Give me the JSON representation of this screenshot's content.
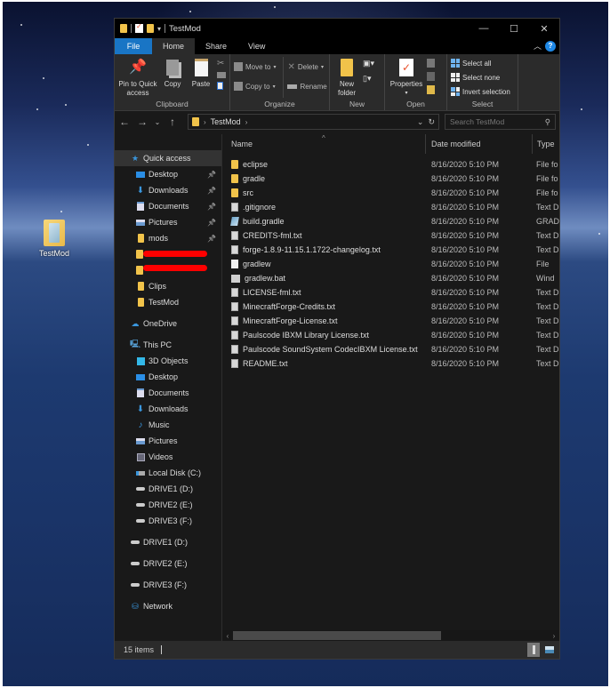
{
  "desktop": {
    "icon_label": "TestMod"
  },
  "window": {
    "title": "TestMod",
    "controls": {
      "minimize": "—",
      "maximize": "☐",
      "close": "✕"
    }
  },
  "ribbon_tabs": {
    "file": "File",
    "home": "Home",
    "share": "Share",
    "view": "View"
  },
  "ribbon": {
    "clipboard": {
      "label": "Clipboard",
      "pin": "Pin to Quick access",
      "copy": "Copy",
      "paste": "Paste"
    },
    "organize": {
      "label": "Organize",
      "move_to": "Move to",
      "copy_to": "Copy to",
      "delete": "Delete",
      "rename": "Rename"
    },
    "new": {
      "label": "New",
      "new_folder": "New folder"
    },
    "open": {
      "label": "Open",
      "properties": "Properties"
    },
    "select": {
      "label": "Select",
      "select_all": "Select all",
      "select_none": "Select none",
      "invert_selection": "Invert selection"
    }
  },
  "address": {
    "path": "TestMod",
    "search_placeholder": "Search TestMod"
  },
  "navpane": {
    "quick_access": "Quick access",
    "quick_items": [
      {
        "label": "Desktop",
        "icon": "desktop-icon",
        "pinned": true
      },
      {
        "label": "Downloads",
        "icon": "downloads-icon",
        "pinned": true
      },
      {
        "label": "Documents",
        "icon": "documents-icon",
        "pinned": true
      },
      {
        "label": "Pictures",
        "icon": "pictures-icon",
        "pinned": true
      },
      {
        "label": "mods",
        "icon": "folder-icon",
        "pinned": true
      }
    ],
    "quick_items_after_redacted": [
      {
        "label": "Clips",
        "icon": "folder-icon"
      },
      {
        "label": "TestMod",
        "icon": "folder-icon"
      }
    ],
    "onedrive": "OneDrive",
    "this_pc": "This PC",
    "pc_items": [
      {
        "label": "3D Objects",
        "icon": "3d-objects-icon"
      },
      {
        "label": "Desktop",
        "icon": "desktop-icon"
      },
      {
        "label": "Documents",
        "icon": "documents-icon"
      },
      {
        "label": "Downloads",
        "icon": "downloads-icon"
      },
      {
        "label": "Music",
        "icon": "music-icon"
      },
      {
        "label": "Pictures",
        "icon": "pictures-icon"
      },
      {
        "label": "Videos",
        "icon": "videos-icon"
      },
      {
        "label": "Local Disk (C:)",
        "icon": "local-disk-icon"
      },
      {
        "label": "DRIVE1 (D:)",
        "icon": "drive-icon"
      },
      {
        "label": "DRIVE2 (E:)",
        "icon": "drive-icon"
      },
      {
        "label": "DRIVE3 (F:)",
        "icon": "drive-icon"
      }
    ],
    "drives": [
      {
        "label": "DRIVE1 (D:)"
      },
      {
        "label": "DRIVE2 (E:)"
      },
      {
        "label": "DRIVE3 (F:)"
      }
    ],
    "network": "Network"
  },
  "columns": {
    "name": "Name",
    "date": "Date modified",
    "type": "Type"
  },
  "files": [
    {
      "name": "eclipse",
      "date": "8/16/2020 5:10 PM",
      "type": "File fo",
      "kind": "folder"
    },
    {
      "name": "gradle",
      "date": "8/16/2020 5:10 PM",
      "type": "File fo",
      "kind": "folder"
    },
    {
      "name": "src",
      "date": "8/16/2020 5:10 PM",
      "type": "File fo",
      "kind": "folder"
    },
    {
      "name": ".gitignore",
      "date": "8/16/2020 5:10 PM",
      "type": "Text D",
      "kind": "text"
    },
    {
      "name": "build.gradle",
      "date": "8/16/2020 5:10 PM",
      "type": "GRAD",
      "kind": "gradle"
    },
    {
      "name": "CREDITS-fml.txt",
      "date": "8/16/2020 5:10 PM",
      "type": "Text D",
      "kind": "text"
    },
    {
      "name": "forge-1.8.9-11.15.1.1722-changelog.txt",
      "date": "8/16/2020 5:10 PM",
      "type": "Text D",
      "kind": "text"
    },
    {
      "name": "gradlew",
      "date": "8/16/2020 5:10 PM",
      "type": "File",
      "kind": "file"
    },
    {
      "name": "gradlew.bat",
      "date": "8/16/2020 5:10 PM",
      "type": "Wind",
      "kind": "bat"
    },
    {
      "name": "LICENSE-fml.txt",
      "date": "8/16/2020 5:10 PM",
      "type": "Text D",
      "kind": "text"
    },
    {
      "name": "MinecraftForge-Credits.txt",
      "date": "8/16/2020 5:10 PM",
      "type": "Text D",
      "kind": "text"
    },
    {
      "name": "MinecraftForge-License.txt",
      "date": "8/16/2020 5:10 PM",
      "type": "Text D",
      "kind": "text"
    },
    {
      "name": "Paulscode IBXM Library License.txt",
      "date": "8/16/2020 5:10 PM",
      "type": "Text D",
      "kind": "text"
    },
    {
      "name": "Paulscode SoundSystem CodecIBXM License.txt",
      "date": "8/16/2020 5:10 PM",
      "type": "Text D",
      "kind": "text"
    },
    {
      "name": "README.txt",
      "date": "8/16/2020 5:10 PM",
      "type": "Text D",
      "kind": "text"
    }
  ],
  "status": {
    "item_count": "15 items"
  },
  "colors": {
    "accent": "#1975c5",
    "folder": "#f1c34a",
    "redaction": "#ff0000"
  }
}
